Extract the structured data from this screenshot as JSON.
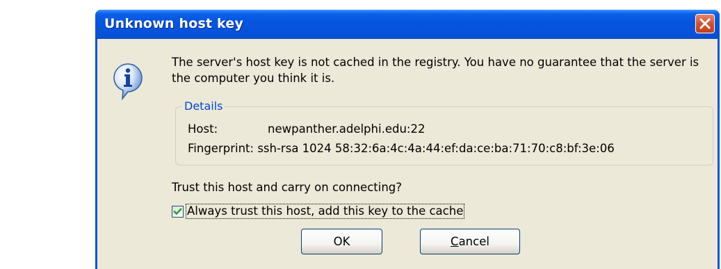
{
  "dialog": {
    "title": "Unknown host key",
    "message": "The server's host key is not cached in the registry. You have no guarantee that the server is the computer you think it is.",
    "details": {
      "legend": "Details",
      "host_label": "Host:",
      "host_value": "newpanther.adelphi.edu:22",
      "fingerprint_label": "Fingerprint:",
      "fingerprint_value": "ssh-rsa 1024 58:32:6a:4c:4a:44:ef:da:ce:ba:71:70:c8:bf:3e:06"
    },
    "question": "Trust this host and carry on connecting?",
    "trust_checkbox": {
      "label": "Always trust this host, add this key to the cache",
      "checked": true
    },
    "buttons": {
      "ok_label": "OK",
      "cancel_first": "C",
      "cancel_rest": "ancel"
    }
  },
  "icons": {
    "close": "close-icon",
    "info": "info-icon",
    "check": "check-icon",
    "pointer_arrow": "right-arrow-icon"
  },
  "colors": {
    "titlebar": "#0553dc",
    "client": "#ece9d8",
    "legend": "#0046d5",
    "close_button": "#d4512e",
    "checkmark": "#21a121",
    "arrow_fill": "#a7c8f2"
  }
}
